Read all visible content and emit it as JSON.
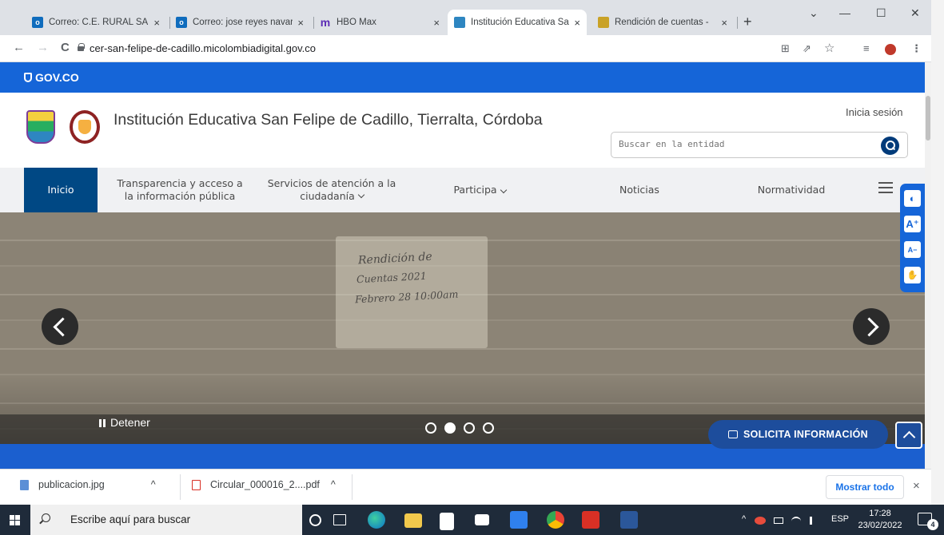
{
  "browser": {
    "tabs": [
      {
        "title": "Correo: C.E. RURAL SAN",
        "active": false
      },
      {
        "title": "Correo: jose reyes navarr",
        "active": false
      },
      {
        "title": "HBO Max",
        "active": false
      },
      {
        "title": "Institución Educativa San",
        "active": true
      },
      {
        "title": "Rendición de cuentas - ",
        "active": false
      }
    ],
    "tab_close": "×",
    "new_tab": "+",
    "window_controls": {
      "minimize": "—",
      "maximize": "☐",
      "close": "✕",
      "dropdown": "⌄"
    },
    "url": "cer-san-felipe-de-cadillo.micolombiadigital.gov.co",
    "nav": {
      "back": "←",
      "forward": "→",
      "reload": "C"
    },
    "toolbar_icons": [
      "translate-icon",
      "share-icon",
      "star-icon",
      "reading-list-icon",
      "profile-icon",
      "menu-icon"
    ],
    "toolbar_glyphs": {
      "translate": "⊞",
      "share": "⇗",
      "star": "☆",
      "reading": "≡",
      "menu": "⋮"
    }
  },
  "site": {
    "gov_logo": "GOV.CO",
    "title": "Institución Educativa San Felipe de Cadillo, Tierralta, Córdoba",
    "login": "Inicia sesión",
    "search_placeholder": "Buscar en la entidad",
    "menu": [
      {
        "label": "Inicio",
        "active": true
      },
      {
        "label": "Transparencia y acceso a la información pública"
      },
      {
        "label": "Servicios de atención a la ciudadanía"
      },
      {
        "label": "Participa"
      },
      {
        "label": "Noticias"
      },
      {
        "label": "Normatividad"
      }
    ],
    "carousel": {
      "handwritten_lines": [
        "Rendición de",
        "Cuentas 2021",
        "Febrero 28 10:00am"
      ],
      "stop_label": "Detener",
      "slides": 4,
      "current_slide": 2
    },
    "solicita_label": "SOLICITA INFORMACIÓN",
    "accessibility": [
      "contrast-icon",
      "font-increase-icon",
      "font-decrease-icon",
      "sign-language-icon"
    ],
    "accessibility_labels": {
      "contrast": "◐",
      "increase": "A⁺",
      "decrease": "A−",
      "sign": "✋"
    }
  },
  "downloads": {
    "items": [
      {
        "name": "publicacion.jpg",
        "chevron": "^"
      },
      {
        "name": "Circular_000016_2....pdf",
        "chevron": "^"
      }
    ],
    "show_all": "Mostrar todo",
    "close": "×"
  },
  "taskbar": {
    "search_placeholder": "Escribe aquí para buscar",
    "tray": {
      "lang": "ESP",
      "chevron": "^"
    },
    "time": "17:28",
    "date": "23/02/2022",
    "notifications": "4"
  },
  "colors": {
    "gov_blue": "#1565d8",
    "menu_active": "#004884",
    "solicita": "#1d4d9c",
    "taskbar": "#1f2b3a"
  }
}
